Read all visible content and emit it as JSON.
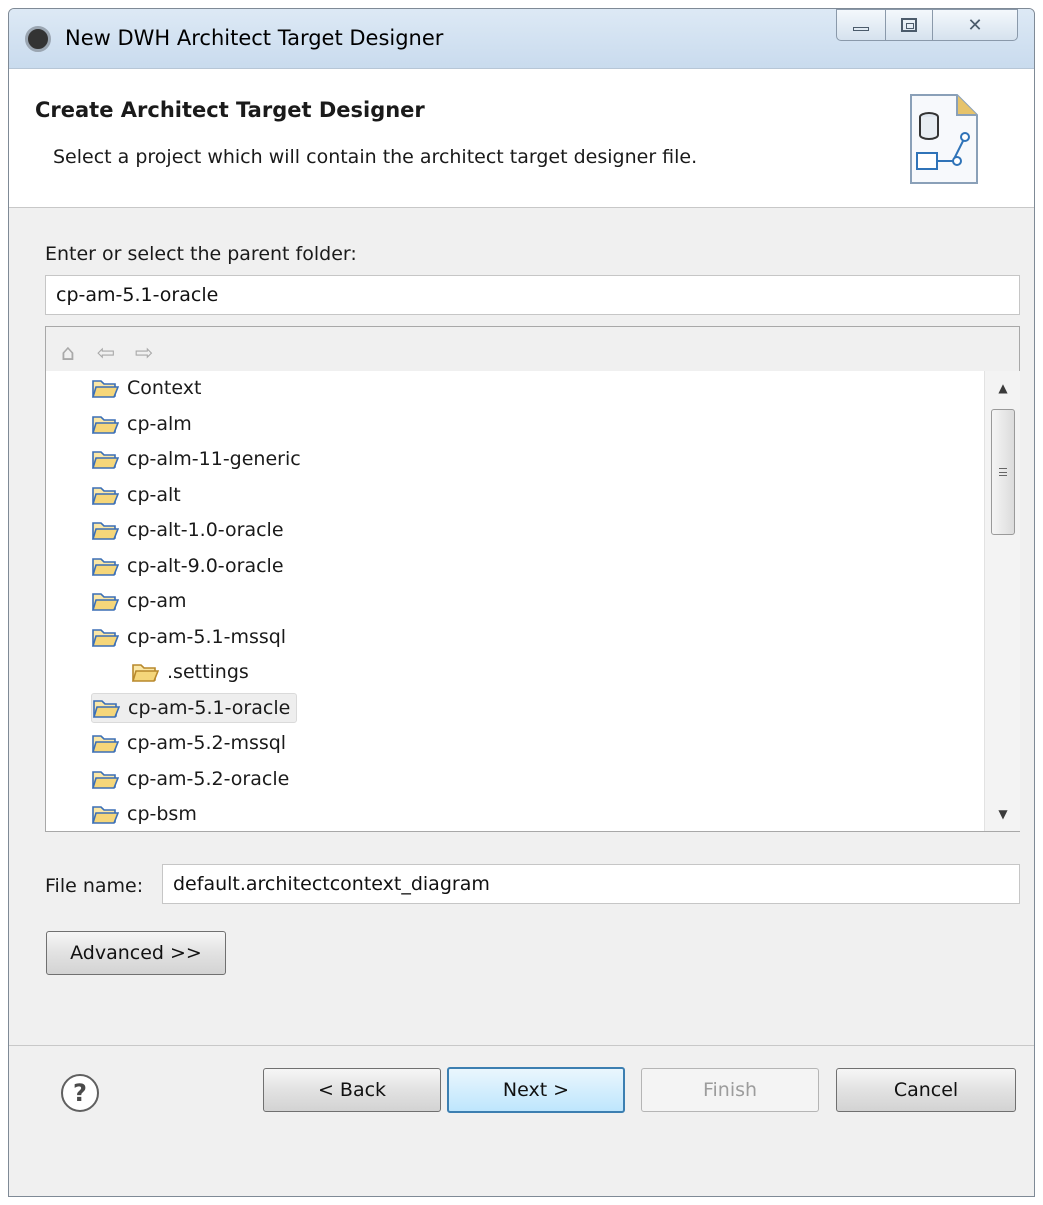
{
  "window": {
    "title": "New DWH Architect Target Designer",
    "app_icon": "eclipse-icon",
    "controls": [
      "minimize-icon",
      "maximize-icon",
      "close-icon"
    ]
  },
  "header": {
    "title": "Create Architect Target Designer",
    "description": "Select a project which will contain the architect target designer file.",
    "icon": "wizard-banner-icon"
  },
  "parent_folder": {
    "label": "Enter or select the parent folder:",
    "value": "cp-am-5.1-oracle"
  },
  "tree": {
    "toolbar": [
      "home-icon",
      "back-arrow-icon",
      "forward-arrow-icon"
    ],
    "items": [
      {
        "label": "Context",
        "level": 0
      },
      {
        "label": "cp-alm",
        "level": 0
      },
      {
        "label": "cp-alm-11-generic",
        "level": 0
      },
      {
        "label": "cp-alt",
        "level": 0
      },
      {
        "label": "cp-alt-1.0-oracle",
        "level": 0
      },
      {
        "label": "cp-alt-9.0-oracle",
        "level": 0
      },
      {
        "label": "cp-am",
        "level": 0
      },
      {
        "label": "cp-am-5.1-mssql",
        "level": 0
      },
      {
        "label": ".settings",
        "level": 1
      },
      {
        "label": "cp-am-5.1-oracle",
        "level": 0,
        "selected": true
      },
      {
        "label": "cp-am-5.2-mssql",
        "level": 0
      },
      {
        "label": "cp-am-5.2-oracle",
        "level": 0
      },
      {
        "label": "cp-bsm",
        "level": 0
      }
    ]
  },
  "file_name": {
    "label": "File name:",
    "value": "default.architectcontext_diagram"
  },
  "buttons": {
    "advanced": "Advanced >>",
    "back": "< Back",
    "next": "Next >",
    "finish": "Finish",
    "cancel": "Cancel"
  },
  "colors": {
    "folder_fill": "#f5d67a",
    "folder_stroke": "#3b6fb6",
    "default_button_border": "#3c7fb1"
  }
}
